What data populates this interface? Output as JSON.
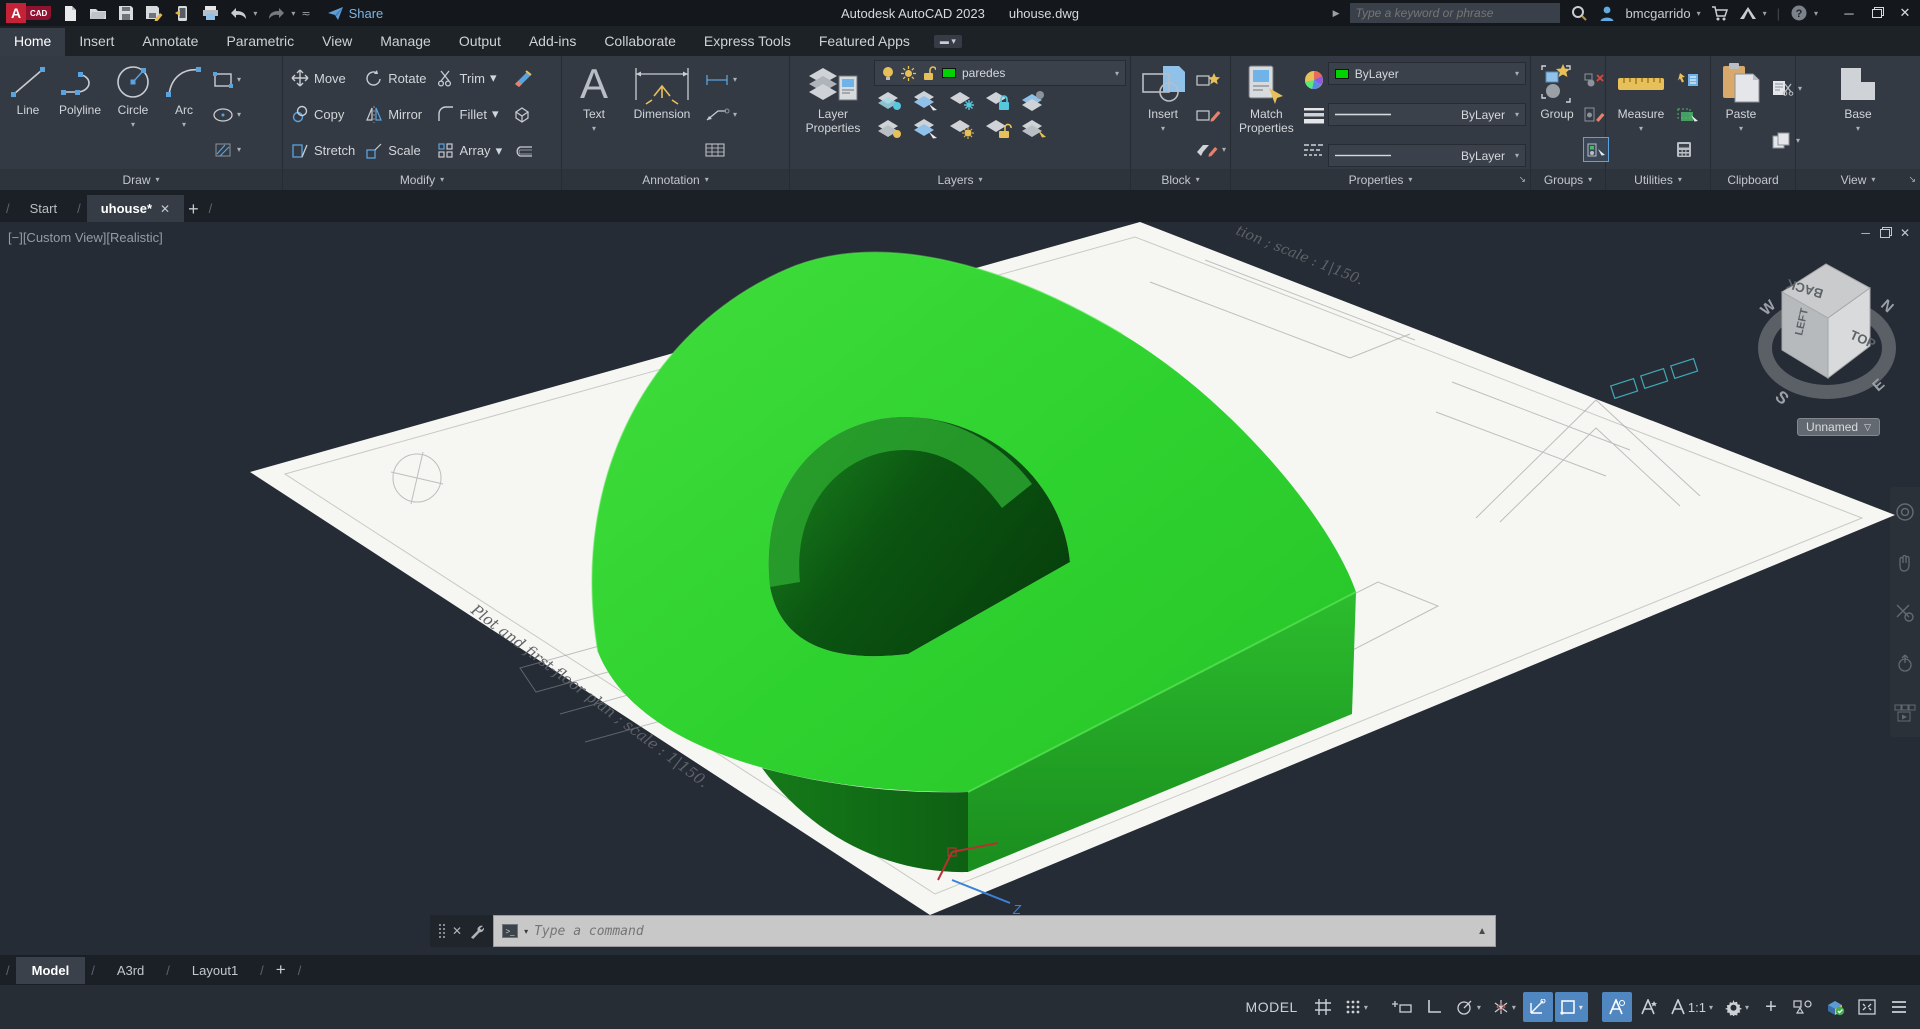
{
  "window": {
    "app_title": "Autodesk AutoCAD 2023",
    "doc_title": "uhouse.dwg",
    "share_label": "Share",
    "search_placeholder": "Type a keyword or phrase",
    "username": "bmcgarrido"
  },
  "ribbon": {
    "tabs": [
      "Home",
      "Insert",
      "Annotate",
      "Parametric",
      "View",
      "Manage",
      "Output",
      "Add-ins",
      "Collaborate",
      "Express Tools",
      "Featured Apps"
    ],
    "draw": {
      "label": "Draw",
      "line": "Line",
      "polyline": "Polyline",
      "circle": "Circle",
      "arc": "Arc"
    },
    "modify": {
      "label": "Modify",
      "move": "Move",
      "rotate": "Rotate",
      "trim": "Trim",
      "copy": "Copy",
      "mirror": "Mirror",
      "fillet": "Fillet",
      "stretch": "Stretch",
      "scale": "Scale",
      "array": "Array"
    },
    "annotation": {
      "label": "Annotation",
      "text": "Text",
      "dimension": "Dimension"
    },
    "layers": {
      "label": "Layers",
      "big1": "Layer",
      "big2": "Properties",
      "current_layer": "paredes"
    },
    "block": {
      "label": "Block",
      "big": "Insert"
    },
    "properties": {
      "label": "Properties",
      "big1": "Match",
      "big2": "Properties",
      "color": "ByLayer",
      "lineweight": "ByLayer",
      "linetype": "ByLayer"
    },
    "groups": {
      "label": "Groups",
      "big": "Group"
    },
    "utilities": {
      "label": "Utilities",
      "big": "Measure"
    },
    "clipboard": {
      "label": "Clipboard",
      "big": "Paste"
    },
    "view": {
      "label": "View",
      "big": "Base"
    }
  },
  "file_tabs": {
    "start": "Start",
    "doc": "uhouse*"
  },
  "viewport": {
    "view_label": "[−][Custom View][Realistic]",
    "viewcube": {
      "top": "TOP",
      "back": "BACK",
      "left": "LEFT",
      "n": "N",
      "e": "E",
      "s": "S",
      "w": "W",
      "named_view": "Unnamed"
    },
    "plan_caption_left": "Plot and first-floor plan ; scale :   1|150.",
    "plan_caption_top": "tion ; scale :   1|150.",
    "ucs_axis_label": "Z"
  },
  "command_line": {
    "placeholder": "Type a command"
  },
  "layout_tabs": {
    "model": "Model",
    "a3rd": "A3rd",
    "layout1": "Layout1"
  },
  "status_bar": {
    "model_label": "MODEL",
    "annotation_scale": "1:1"
  },
  "icons": {
    "caret": "▾",
    "close": "✕",
    "minimize": "─",
    "plus": "+",
    "slash": "/",
    "up": "▲",
    "launcher": "↘"
  },
  "colors": {
    "solid_top": "#31d231",
    "solid_side": "#24ad27",
    "solid_inner_dark": "#07420c",
    "layer_green": "#00d400",
    "status_active": "#5087c0"
  }
}
